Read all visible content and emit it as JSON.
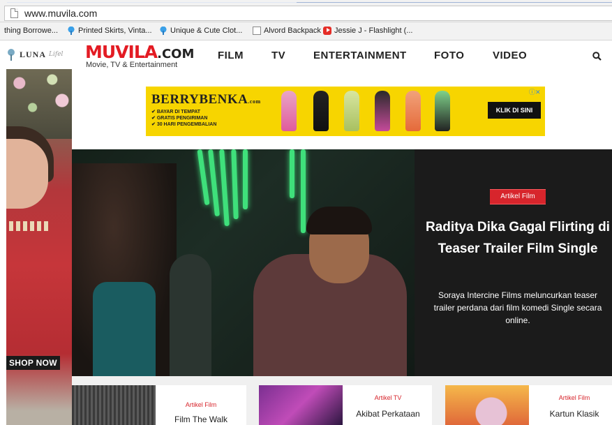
{
  "browser": {
    "url": "www.muvila.com",
    "bookmarks": [
      {
        "label": "thing Borrowe...",
        "icon": "none"
      },
      {
        "label": "Printed Skirts, Vinta...",
        "icon": "tree-icon"
      },
      {
        "label": "Unique & Cute Clot...",
        "icon": "tree-icon"
      },
      {
        "label": "Alvord Backpack",
        "icon": "page-icon"
      },
      {
        "label": "Jessie J - Flashlight (...",
        "icon": "youtube-icon"
      }
    ]
  },
  "header": {
    "side_logo": {
      "text": "LUNA",
      "script": "Lifel"
    },
    "logo": {
      "main": "MUVILA",
      "suffix": ".COM",
      "tagline": "Movie, TV & Entertainment"
    },
    "nav": [
      "FILM",
      "TV",
      "ENTERTAINMENT",
      "FOTO",
      "VIDEO"
    ],
    "accent_color": "#e31b23"
  },
  "side_ad": {
    "cta": "SHOP NOW"
  },
  "banner": {
    "brand": "BERRYBENKA",
    "brand_suffix": ".com",
    "perks": [
      "BAYAR DI TEMPAT",
      "GRATIS PENGIRIMAN",
      "30 HARI PENGEMBALIAN"
    ],
    "cta": "KLIK DI SINI"
  },
  "hero": {
    "category": "Artikel Film",
    "title": "Raditya Dika Gagal Flirting di Teaser Trailer Film Single",
    "description": "Soraya Intercine Films meluncurkan teaser trailer perdana dari film komedi Single secara online."
  },
  "cards": [
    {
      "category": "Artikel Film",
      "title": "Film The Walk"
    },
    {
      "category": "Artikel TV",
      "title": "Akibat Perkataan"
    },
    {
      "category": "Artikel Film",
      "title": "Kartun Klasik"
    }
  ]
}
